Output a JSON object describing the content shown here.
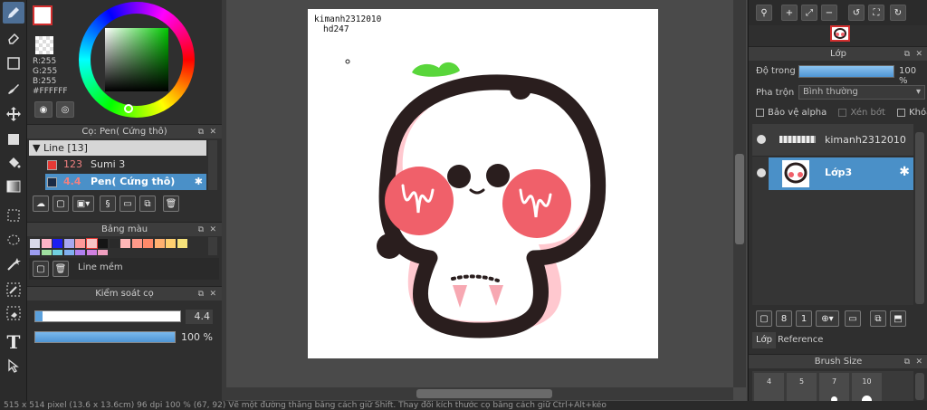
{
  "toolbar": {
    "tools": [
      "pen-tool",
      "eraser-tool",
      "rectangle-select-tool",
      "brush-tool",
      "move-tool",
      "fill-rect-tool",
      "bucket-tool",
      "gradient-tool",
      "select-rect-tool",
      "lasso-tool",
      "magic-wand-tool",
      "select-pen-tool",
      "select-eraser-tool",
      "text-tool",
      "operation-tool"
    ],
    "text_tool_glyph": "T"
  },
  "color": {
    "r_label": "R:255",
    "g_label": "G:255",
    "b_label": "B:255",
    "hex": "#FFFFFF",
    "foreground": "#ffffff",
    "background": "#ffffff"
  },
  "brush_panel": {
    "title": "Cọ: Pen( Cứng thô)",
    "group_label": "Line [13]",
    "items": [
      {
        "size": "123",
        "name": "Sumi 3",
        "color": "#e53935"
      },
      {
        "size": "4.4",
        "name": "Pen( Cứng thô)",
        "color": "#1a2b44"
      }
    ]
  },
  "palette_panel": {
    "title": "Bảng màu",
    "row1": [
      "#d8d8e8",
      "#ffb3c7",
      "#1e1ef0",
      "#a8a8f0",
      "#ff9a9a",
      "#f7c6c6",
      "#151515",
      "#2a2a2a",
      "#ffb8b8",
      "#ff9a8a",
      "#ff8a6a",
      "#ffb070",
      "#ffd070",
      "#f6e27a"
    ],
    "row2": [
      "#9c9cf0",
      "#a0e0a0",
      "#70d0e0",
      "#80b0f0",
      "#b080f0",
      "#d080e0",
      "#f0a0c0"
    ],
    "palette_name": "Line mềm"
  },
  "brush_control": {
    "title": "Kiểm soát cọ",
    "size_value": "4.4",
    "size_fraction": 0.05,
    "opacity_value": "100 %",
    "opacity_fraction": 1.0
  },
  "canvas": {
    "text_line1": "kimanh2312010",
    "text_line2": "hd247"
  },
  "navigator": {
    "zoom_in": "+",
    "zoom_out": "−"
  },
  "layer_panel": {
    "title": "Lớp",
    "opacity_label": "Độ trong",
    "opacity_value": "100 %",
    "blend_label": "Pha trộn",
    "blend_value": "Bình thường",
    "protect_alpha": "Bảo vệ alpha",
    "clipping": "Xén bớt",
    "lock": "Khóa",
    "layers": [
      {
        "name": "kimanh2312010",
        "selected": false
      },
      {
        "name": "Lớp3",
        "selected": true
      }
    ],
    "tabs": [
      "Lớp",
      "Reference"
    ]
  },
  "brush_size_panel": {
    "title": "Brush Size",
    "sizes": [
      "4",
      "5",
      "7",
      "10"
    ]
  },
  "status": {
    "text": "515 x 514 pixel (13.6 x 13.6cm)  96 dpi  100 %  (67, 92)  Vẽ một đường thẳng bằng cách giữ Shift. Thay đổi kích thước cọ bằng cách giữ Ctrl+Alt+kéo"
  }
}
